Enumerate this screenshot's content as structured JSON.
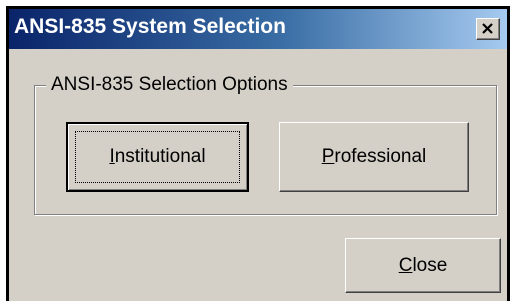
{
  "window": {
    "title": "ANSI-835 System Selection"
  },
  "group": {
    "label": "ANSI-835 Selection Options"
  },
  "buttons": {
    "institutional": {
      "mnemonic": "I",
      "rest": "nstitutional"
    },
    "professional": {
      "mnemonic": "P",
      "rest": "rofessional"
    },
    "close": {
      "mnemonic": "C",
      "rest": "lose"
    }
  },
  "icons": {
    "title_close": "close-icon"
  },
  "colors": {
    "titlebar_start": "#0a246a",
    "titlebar_end": "#a6caf0",
    "face": "#d4d0c8"
  }
}
